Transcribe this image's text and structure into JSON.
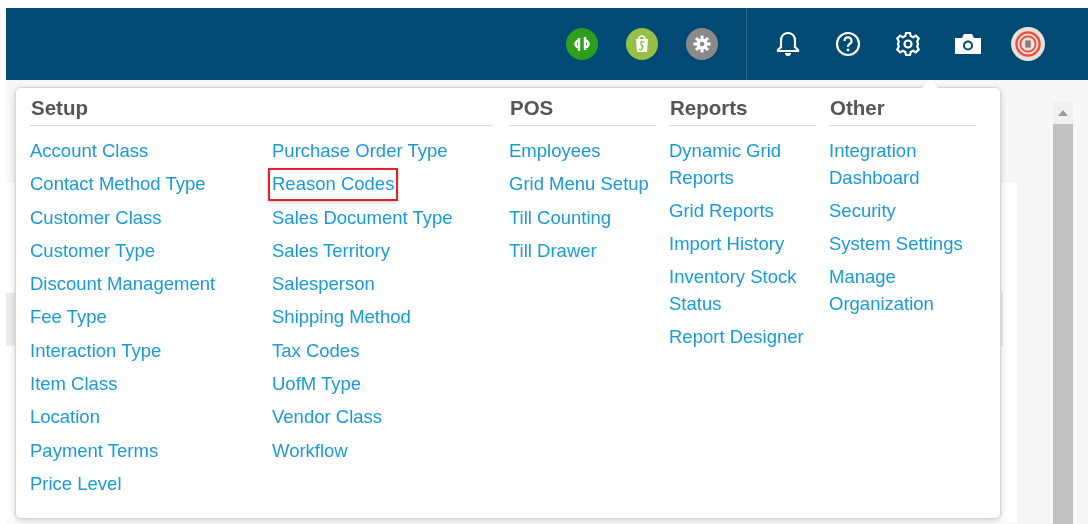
{
  "settings_menu": {
    "sections": [
      {
        "title": "Setup",
        "columns": [
          [
            {
              "label": "Account Class",
              "highlighted": false
            },
            {
              "label": "Contact Method Type",
              "highlighted": false
            },
            {
              "label": "Customer Class",
              "highlighted": false
            },
            {
              "label": "Customer Type",
              "highlighted": false
            },
            {
              "label": "Discount Management",
              "highlighted": false
            },
            {
              "label": "Fee Type",
              "highlighted": false
            },
            {
              "label": "Interaction Type",
              "highlighted": false
            },
            {
              "label": "Item Class",
              "highlighted": false
            },
            {
              "label": "Location",
              "highlighted": false
            },
            {
              "label": "Payment Terms",
              "highlighted": false
            },
            {
              "label": "Price Level",
              "highlighted": false
            }
          ],
          [
            {
              "label": "Purchase Order Type",
              "highlighted": false
            },
            {
              "label": "Reason Codes",
              "highlighted": true
            },
            {
              "label": "Sales Document Type",
              "highlighted": false
            },
            {
              "label": "Sales Territory",
              "highlighted": false
            },
            {
              "label": "Salesperson",
              "highlighted": false
            },
            {
              "label": "Shipping Method",
              "highlighted": false
            },
            {
              "label": "Tax Codes",
              "highlighted": false
            },
            {
              "label": "UofM Type",
              "highlighted": false
            },
            {
              "label": "Vendor Class",
              "highlighted": false
            },
            {
              "label": "Workflow",
              "highlighted": false
            }
          ]
        ]
      },
      {
        "title": "POS",
        "columns": [
          [
            {
              "label": "Employees",
              "highlighted": false
            },
            {
              "label": "Grid Menu Setup",
              "highlighted": false
            },
            {
              "label": "Till Counting",
              "highlighted": false
            },
            {
              "label": "Till Drawer",
              "highlighted": false
            }
          ]
        ]
      },
      {
        "title": "Reports",
        "columns": [
          [
            {
              "label": "Dynamic Grid Reports",
              "highlighted": false
            },
            {
              "label": "Grid Reports",
              "highlighted": false
            },
            {
              "label": "Import History",
              "highlighted": false
            },
            {
              "label": "Inventory Stock Status",
              "highlighted": false
            },
            {
              "label": "Report Designer",
              "highlighted": false
            }
          ]
        ]
      },
      {
        "title": "Other",
        "columns": [
          [
            {
              "label": "Integration Dashboard",
              "highlighted": false
            },
            {
              "label": "Security",
              "highlighted": false
            },
            {
              "label": "System Settings",
              "highlighted": false
            },
            {
              "label": "Manage Organization",
              "highlighted": false
            }
          ]
        ]
      }
    ]
  }
}
